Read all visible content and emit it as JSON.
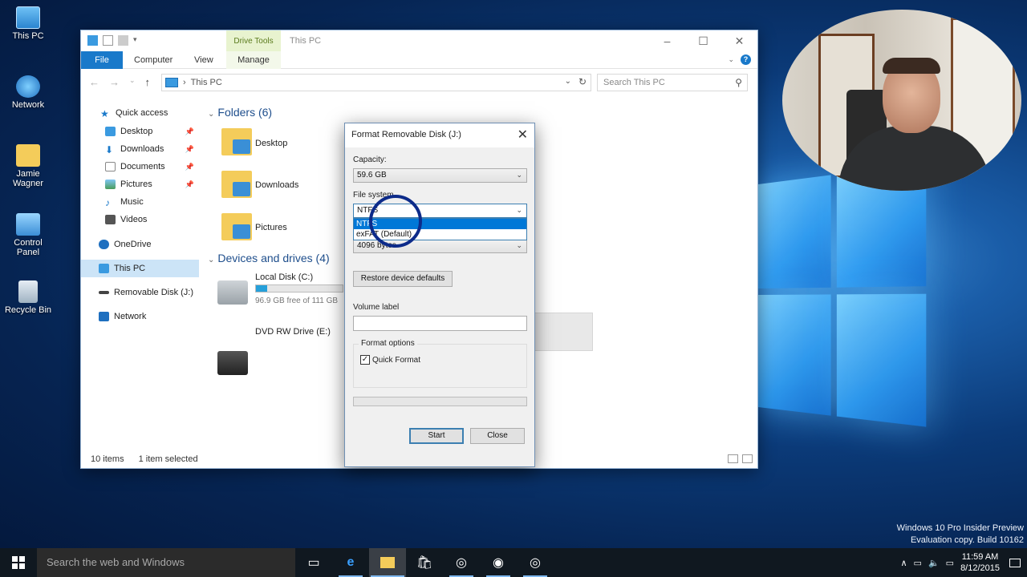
{
  "desktop": {
    "icons": [
      {
        "label": "This PC"
      },
      {
        "label": "Network"
      },
      {
        "label": "Jamie Wagner"
      },
      {
        "label": "Control Panel"
      },
      {
        "label": "Recycle Bin"
      }
    ]
  },
  "explorer": {
    "title": "This PC",
    "drive_tools_label": "Drive Tools",
    "ribbon_tabs": {
      "file": "File",
      "computer": "Computer",
      "view": "View",
      "manage": "Manage"
    },
    "address": {
      "crumb_sep": "›",
      "crumb": "This PC"
    },
    "search_placeholder": "Search This PC",
    "nav": {
      "quick_access": "Quick access",
      "desktop": "Desktop",
      "downloads": "Downloads",
      "documents": "Documents",
      "pictures": "Pictures",
      "music": "Music",
      "videos": "Videos",
      "onedrive": "OneDrive",
      "this_pc": "This PC",
      "removable": "Removable Disk (J:)",
      "network": "Network"
    },
    "folders_header": "Folders (6)",
    "folders": [
      "Desktop",
      "Downloads",
      "Pictures"
    ],
    "devices_header": "Devices and drives (4)",
    "drives": {
      "local": {
        "name": "Local Disk (C:)",
        "free": "96.9 GB free of 111 GB",
        "used_fraction": 0.13
      },
      "dvd": {
        "name": "DVD RW Drive (E:)"
      }
    },
    "status": {
      "items": "10 items",
      "selected": "1 item selected"
    }
  },
  "dialog": {
    "title": "Format Removable Disk (J:)",
    "capacity_label": "Capacity:",
    "capacity_value": "59.6 GB",
    "filesystem_label": "File system",
    "filesystem_value": "NTFS",
    "filesystem_options": [
      "NTFS",
      "exFAT (Default)"
    ],
    "alloc_value": "4096 bytes",
    "restore_button": "Restore device defaults",
    "volume_label": "Volume label",
    "volume_value": "",
    "format_options_label": "Format options",
    "quick_format_label": "Quick Format",
    "quick_format_checked": true,
    "start_button": "Start",
    "close_button": "Close"
  },
  "watermark": {
    "line1": "Windows 10 Pro Insider Preview",
    "line2": "Evaluation copy. Build 10162"
  },
  "taskbar": {
    "search_placeholder": "Search the web and Windows",
    "time": "11:59 AM",
    "date": "8/12/2015"
  },
  "colors": {
    "accent": "#1979ca",
    "selection": "#0078d7",
    "progress": "#26a0da"
  }
}
